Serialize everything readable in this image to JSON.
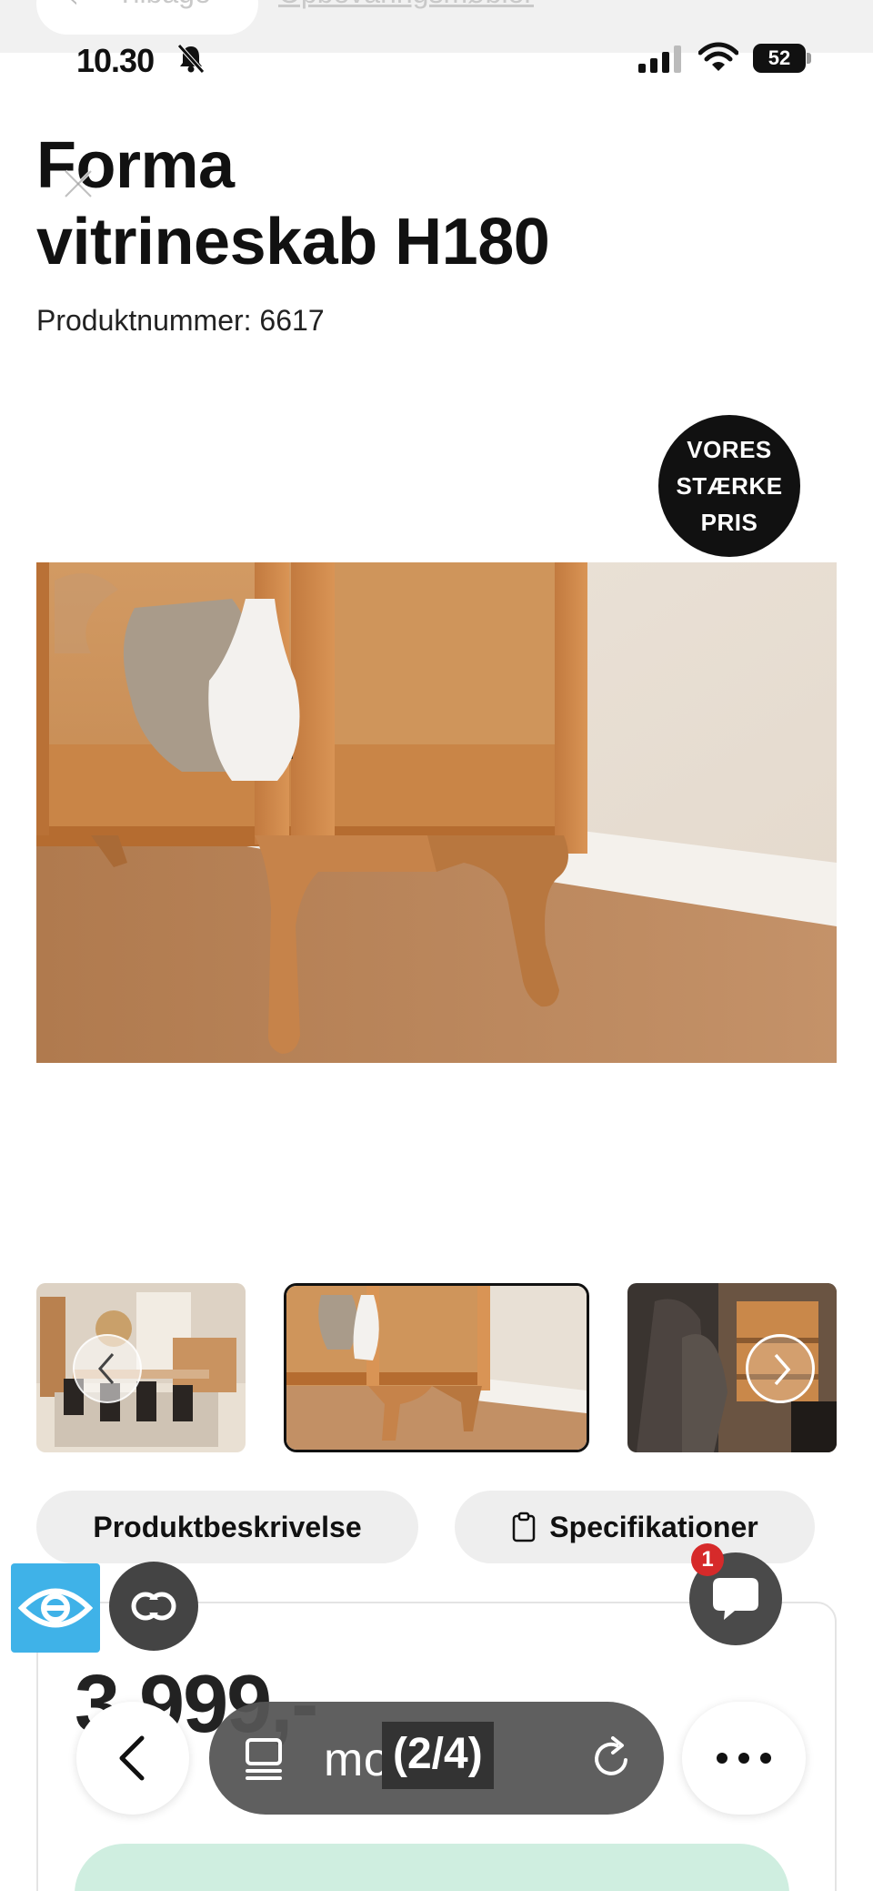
{
  "browser_header": {
    "back_label": "Tilbage",
    "breadcrumb_link": "Opbevaringsmøbler"
  },
  "status_bar": {
    "time": "10.30",
    "battery": "52"
  },
  "product": {
    "title_line1": "Forma",
    "title_line2": "vitrineskab H180",
    "number": "Produktnummer: 6617",
    "badge_line1": "VORES",
    "badge_line2": "STÆRKE",
    "badge_line3": "PRIS",
    "price": "3.999,-"
  },
  "tabs": {
    "description": "Produktbeskrivelse",
    "specifications": "Specifikationer"
  },
  "chat": {
    "unread_count": "1"
  },
  "browser_bar": {
    "url_text": "mo      dk",
    "page_counter": "(2/4)"
  },
  "colors": {
    "accent_blue": "#3fb2e8",
    "badge_black": "#111111",
    "cta_mint": "#cfeee0",
    "notification_red": "#d62a2a"
  }
}
